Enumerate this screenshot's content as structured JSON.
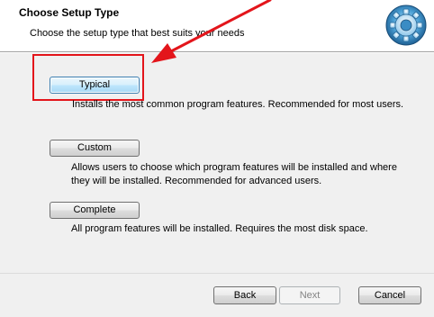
{
  "header": {
    "title": "Choose Setup Type",
    "subtitle": "Choose the setup type that best suits your needs"
  },
  "options": [
    {
      "label": "Typical",
      "description": [
        "Installs the most common program features. Recommended for most users."
      ]
    },
    {
      "label": "Custom",
      "description": [
        "Allows users to choose which program features will be installed and where",
        "they will be installed. Recommended for advanced users."
      ]
    },
    {
      "label": "Complete",
      "description": [
        "All program features will be installed. Requires the most disk space."
      ]
    }
  ],
  "footer": {
    "back_label": "Back",
    "next_label": "Next",
    "cancel_label": "Cancel"
  },
  "annotation": {
    "color": "#e3151b"
  },
  "icons": {
    "logo": "setup-gear-logo-icon",
    "arrow": "red-pointer-arrow-icon"
  }
}
